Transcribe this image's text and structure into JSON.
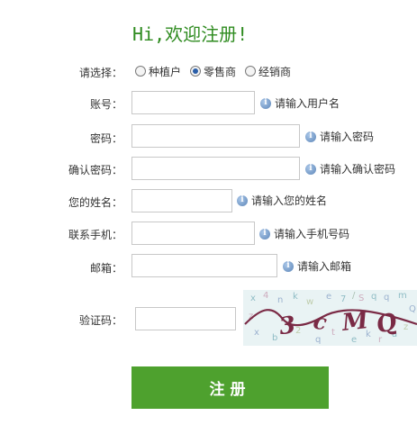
{
  "title": "Hi,欢迎注册!",
  "role": {
    "label": "请选择：",
    "options": [
      {
        "label": "种植户",
        "checked": false
      },
      {
        "label": "零售商",
        "checked": true
      },
      {
        "label": "经销商",
        "checked": false
      }
    ]
  },
  "fields": {
    "account": {
      "label": "账号：",
      "hint": "请输入用户名",
      "value": ""
    },
    "password": {
      "label": "密码：",
      "hint": "请输入密码",
      "value": ""
    },
    "confirm": {
      "label": "确认密码：",
      "hint": "请输入确认密码",
      "value": ""
    },
    "name": {
      "label": "您的姓名：",
      "hint": "请输入您的姓名",
      "value": ""
    },
    "phone": {
      "label": "联系手机：",
      "hint": "请输入手机号码",
      "value": ""
    },
    "email": {
      "label": "邮箱：",
      "hint": "请输入邮箱",
      "value": ""
    },
    "captcha": {
      "label": "验证码：",
      "value": ""
    }
  },
  "captcha_image": {
    "text": "3cMQ"
  },
  "submit_label": "注册"
}
